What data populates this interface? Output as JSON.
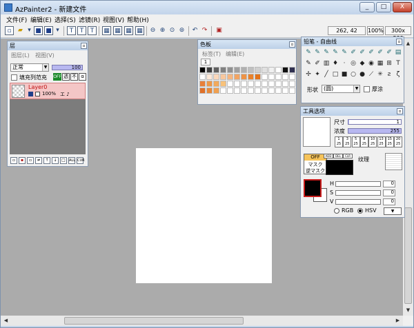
{
  "window": {
    "title": "AzPainter2 - 新建文件",
    "min_glyph": "_",
    "max_glyph": "□",
    "close_glyph": "X"
  },
  "menu": [
    "文件(F)",
    "编辑(E)",
    "选择(S)",
    "滤镜(R)",
    "视图(V)",
    "帮助(H)"
  ],
  "toolbar": {
    "icons": [
      "new-file",
      "open-file",
      "dropdown",
      "save-file",
      "save-as",
      "dropdown",
      "tool-a",
      "tool-b",
      "tool-c",
      "grid",
      "grid-2",
      "grid-3",
      "grid-4",
      "zoom-out",
      "zoom-in",
      "zoom-reset",
      "zoom-fit",
      "undo",
      "redo",
      "capture"
    ],
    "cursor_pos": "262, 42",
    "zoom": "100%",
    "size": "300x 300"
  },
  "layer_panel": {
    "title": "层",
    "tabs": [
      "图层(L)",
      "视图(V)"
    ],
    "blend_mode": "正常",
    "opacity": "100",
    "fill_label": "填充列范充",
    "mode_buttons": [
      "OFF",
      "透",
      "不",
      "α"
    ],
    "layer": {
      "name": "Layer0",
      "opacity_text": "100%",
      "tail": "エ ♪"
    },
    "bottom_buttons": [
      "D",
      "C",
      "M",
      "R",
      "↑",
      "↓",
      "□",
      "ALL",
      "CUR"
    ]
  },
  "color_panel": {
    "title": "色板",
    "tabs": [
      "标签(T)",
      "编辑(E)"
    ],
    "page": "1",
    "colors_row1": [
      "#000000",
      "#404040",
      "#606060",
      "#808080",
      "#909090",
      "#a0a0a0",
      "#b0b0b0",
      "#c0c0c0",
      "#d0d0d0",
      "#e0e0e0",
      "#f0f0f0",
      "#ffffff",
      "#101010",
      "#303050"
    ],
    "colors_row2": [
      "#ffffff",
      "#fde9d9",
      "#fbd8bb",
      "#f8c79d",
      "#f5b680",
      "#f2a462",
      "#ee9346",
      "#ea822a",
      "#e4731a",
      "#ffffff",
      "#ffffff",
      "#ffffff",
      "#ffffff",
      "#ffffff"
    ],
    "colors_row3": [
      "#e8803a",
      "#ee9848",
      "#f2aa5c",
      "#f8c27a",
      "#ffffff",
      "#ffffff",
      "#ffffff",
      "#ffffff",
      "#ffffff",
      "#ffffff",
      "#ffffff",
      "#ffffff",
      "#ffffff",
      "#ffffff"
    ],
    "colors_row4": [
      "#e07028",
      "#e88838",
      "#f0a050",
      "#ffffff",
      "#ffffff",
      "#ffffff",
      "#ffffff",
      "#ffffff",
      "#ffffff",
      "#ffffff",
      "#ffffff",
      "#ffffff",
      "#ffffff",
      "#ffffff"
    ]
  },
  "pencil_panel": {
    "title": "铅笔 - 自由线",
    "tool_icons": [
      "pen-a",
      "pen-b",
      "pen-c",
      "pen-d",
      "pen-e",
      "pen-f",
      "pen-g",
      "pen-h",
      "pen-i",
      "pen-j",
      "stamp",
      "brush-k",
      "pen-l",
      "erase",
      "drop",
      "dotpen",
      "blur",
      "fill",
      "sharpen",
      "grad",
      "lasso",
      "text",
      "move",
      "plus",
      "line",
      "rect",
      "fill-rect",
      "ellipse",
      "fill-ellipse",
      "polyline",
      "rays",
      "curve",
      "zigzag"
    ],
    "shape_label": "形状",
    "shape_value": "(圆)",
    "thick_label": "厚涂"
  },
  "tool_options": {
    "title": "工具选项",
    "size_label": "尺寸",
    "size_value": "1",
    "density_label": "浓度",
    "density_value": "255",
    "preset_top": [
      "1",
      "3",
      "5",
      "8",
      "10",
      "13",
      "15",
      "20"
    ],
    "preset_bot": [
      "25",
      "25",
      "25",
      "25",
      "25",
      "25",
      "25",
      "25"
    ],
    "mask_off": "OFF",
    "mask_labels": [
      "マスク",
      "逆マスク"
    ],
    "mask_buttons": [
      "ADD",
      "DEL",
      "CLR"
    ],
    "texture_label": "纹理"
  },
  "color_picker": {
    "labels": [
      "H",
      "S",
      "V"
    ],
    "values": [
      "0",
      "0",
      "0"
    ],
    "modes": [
      "RGB",
      "HSV"
    ],
    "fg": "#000000",
    "bg": "#ffffff"
  },
  "icons": {
    "check": "✓",
    "arrow_down": "▼",
    "arrow_up": "▲",
    "arrow_left": "◀",
    "arrow_right": "▶"
  }
}
